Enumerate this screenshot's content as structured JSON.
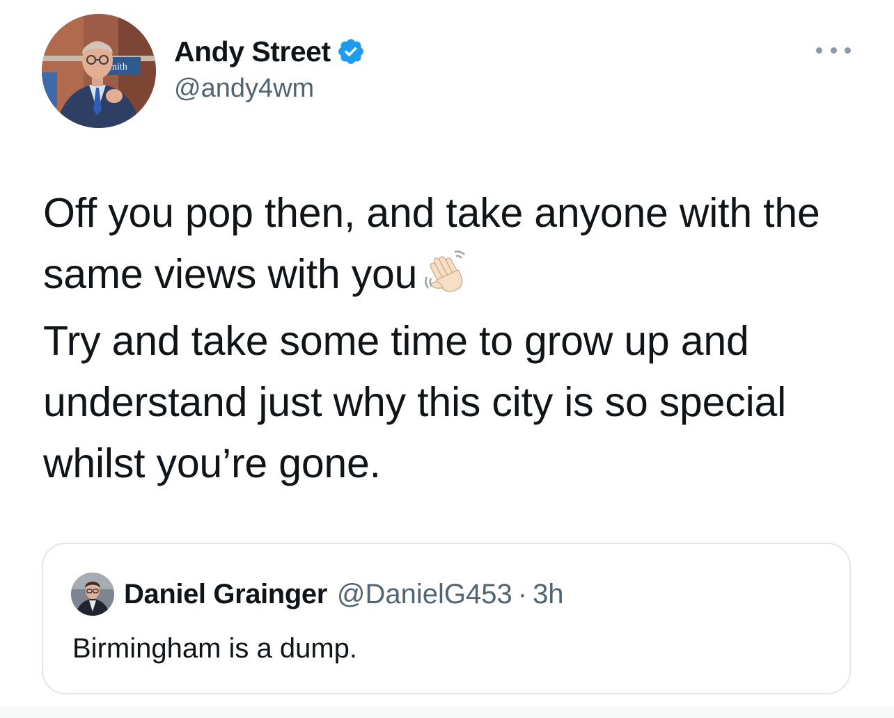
{
  "author": {
    "display_name": "Andy Street",
    "handle": "@andy4wm",
    "verified": true,
    "avatar_icon": "profile-photo",
    "avatar_sign_text": "mith"
  },
  "tweet": {
    "paragraphs": [
      "Off you pop then, and take anyone with the same views with you",
      "Try and take some time to grow up and understand just why this city is so special whilst you’re gone."
    ],
    "emoji": "waving-hand-light-skin-tone"
  },
  "quoted_tweet": {
    "display_name": "Daniel Grainger",
    "handle": "@DanielG453",
    "separator": "·",
    "time": "3h",
    "text": "Birmingham is a dump."
  },
  "colors": {
    "text_primary": "#0f1419",
    "text_secondary": "#536471",
    "verified_blue": "#1d9bf0",
    "border": "#e1e8ed"
  }
}
